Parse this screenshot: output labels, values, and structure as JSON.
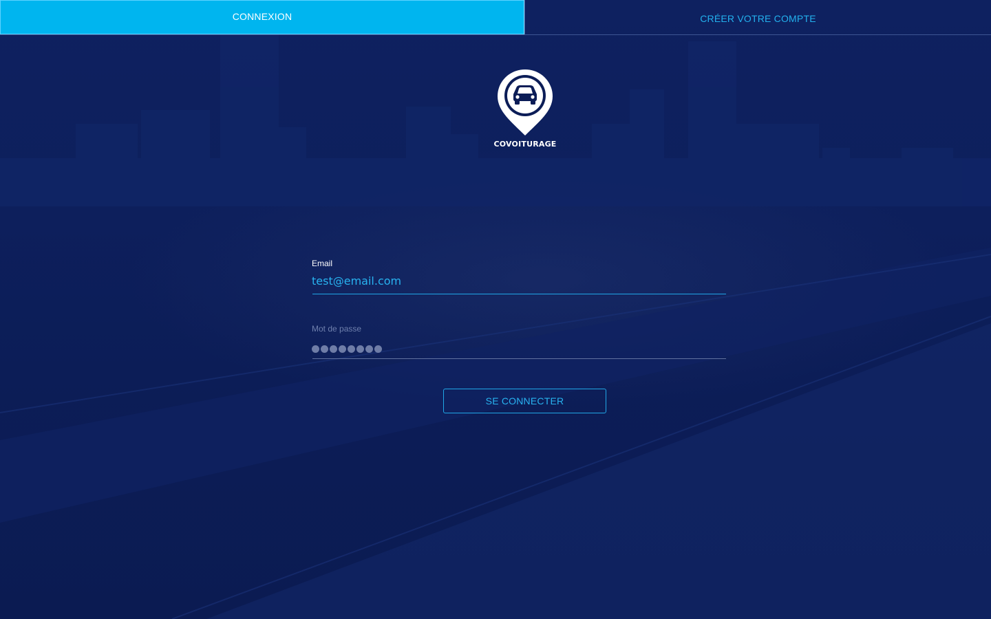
{
  "tabs": {
    "login_label": "CONNEXION",
    "signup_label": "CRÉER VOTRE COMPTE"
  },
  "logo": {
    "text": "COVOITURAGE",
    "icon": "car-map-pin-icon"
  },
  "form": {
    "email_label": "Email",
    "email_value": "test@email.com",
    "password_label": "Mot de passe",
    "password_masked_length": 8
  },
  "submit": {
    "label": "SE CONNECTER"
  },
  "colors": {
    "background": "#0c1d57",
    "accent": "#00b5ef",
    "accent_text": "#28b3f0",
    "muted": "#6f80ad"
  }
}
